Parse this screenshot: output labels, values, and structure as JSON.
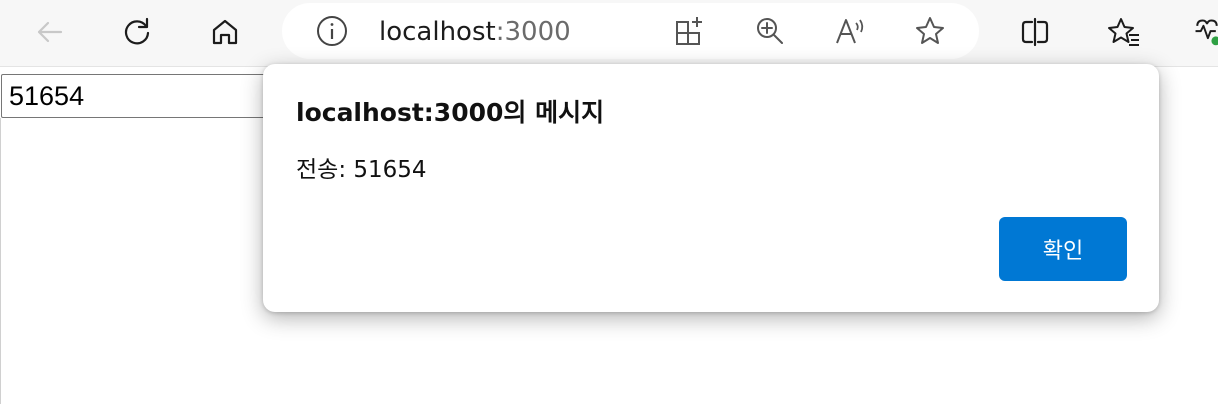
{
  "browser": {
    "toolbar_icons": [
      "back-arrow-icon",
      "refresh-icon",
      "home-icon",
      "split-screen-icon",
      "favorites-list-icon",
      "performance-icon"
    ],
    "address_bar": {
      "url_host": "localhost",
      "url_port": ":3000",
      "icons": [
        "site-info-icon",
        "app-available-icon",
        "zoom-in-icon",
        "read-aloud-icon",
        "favorite-star-icon"
      ]
    }
  },
  "page": {
    "input_value": "51654"
  },
  "dialog": {
    "title": "localhost:3000의 메시지",
    "message": "전송: 51654",
    "ok_label": "확인",
    "button_color": "#0078d4"
  }
}
